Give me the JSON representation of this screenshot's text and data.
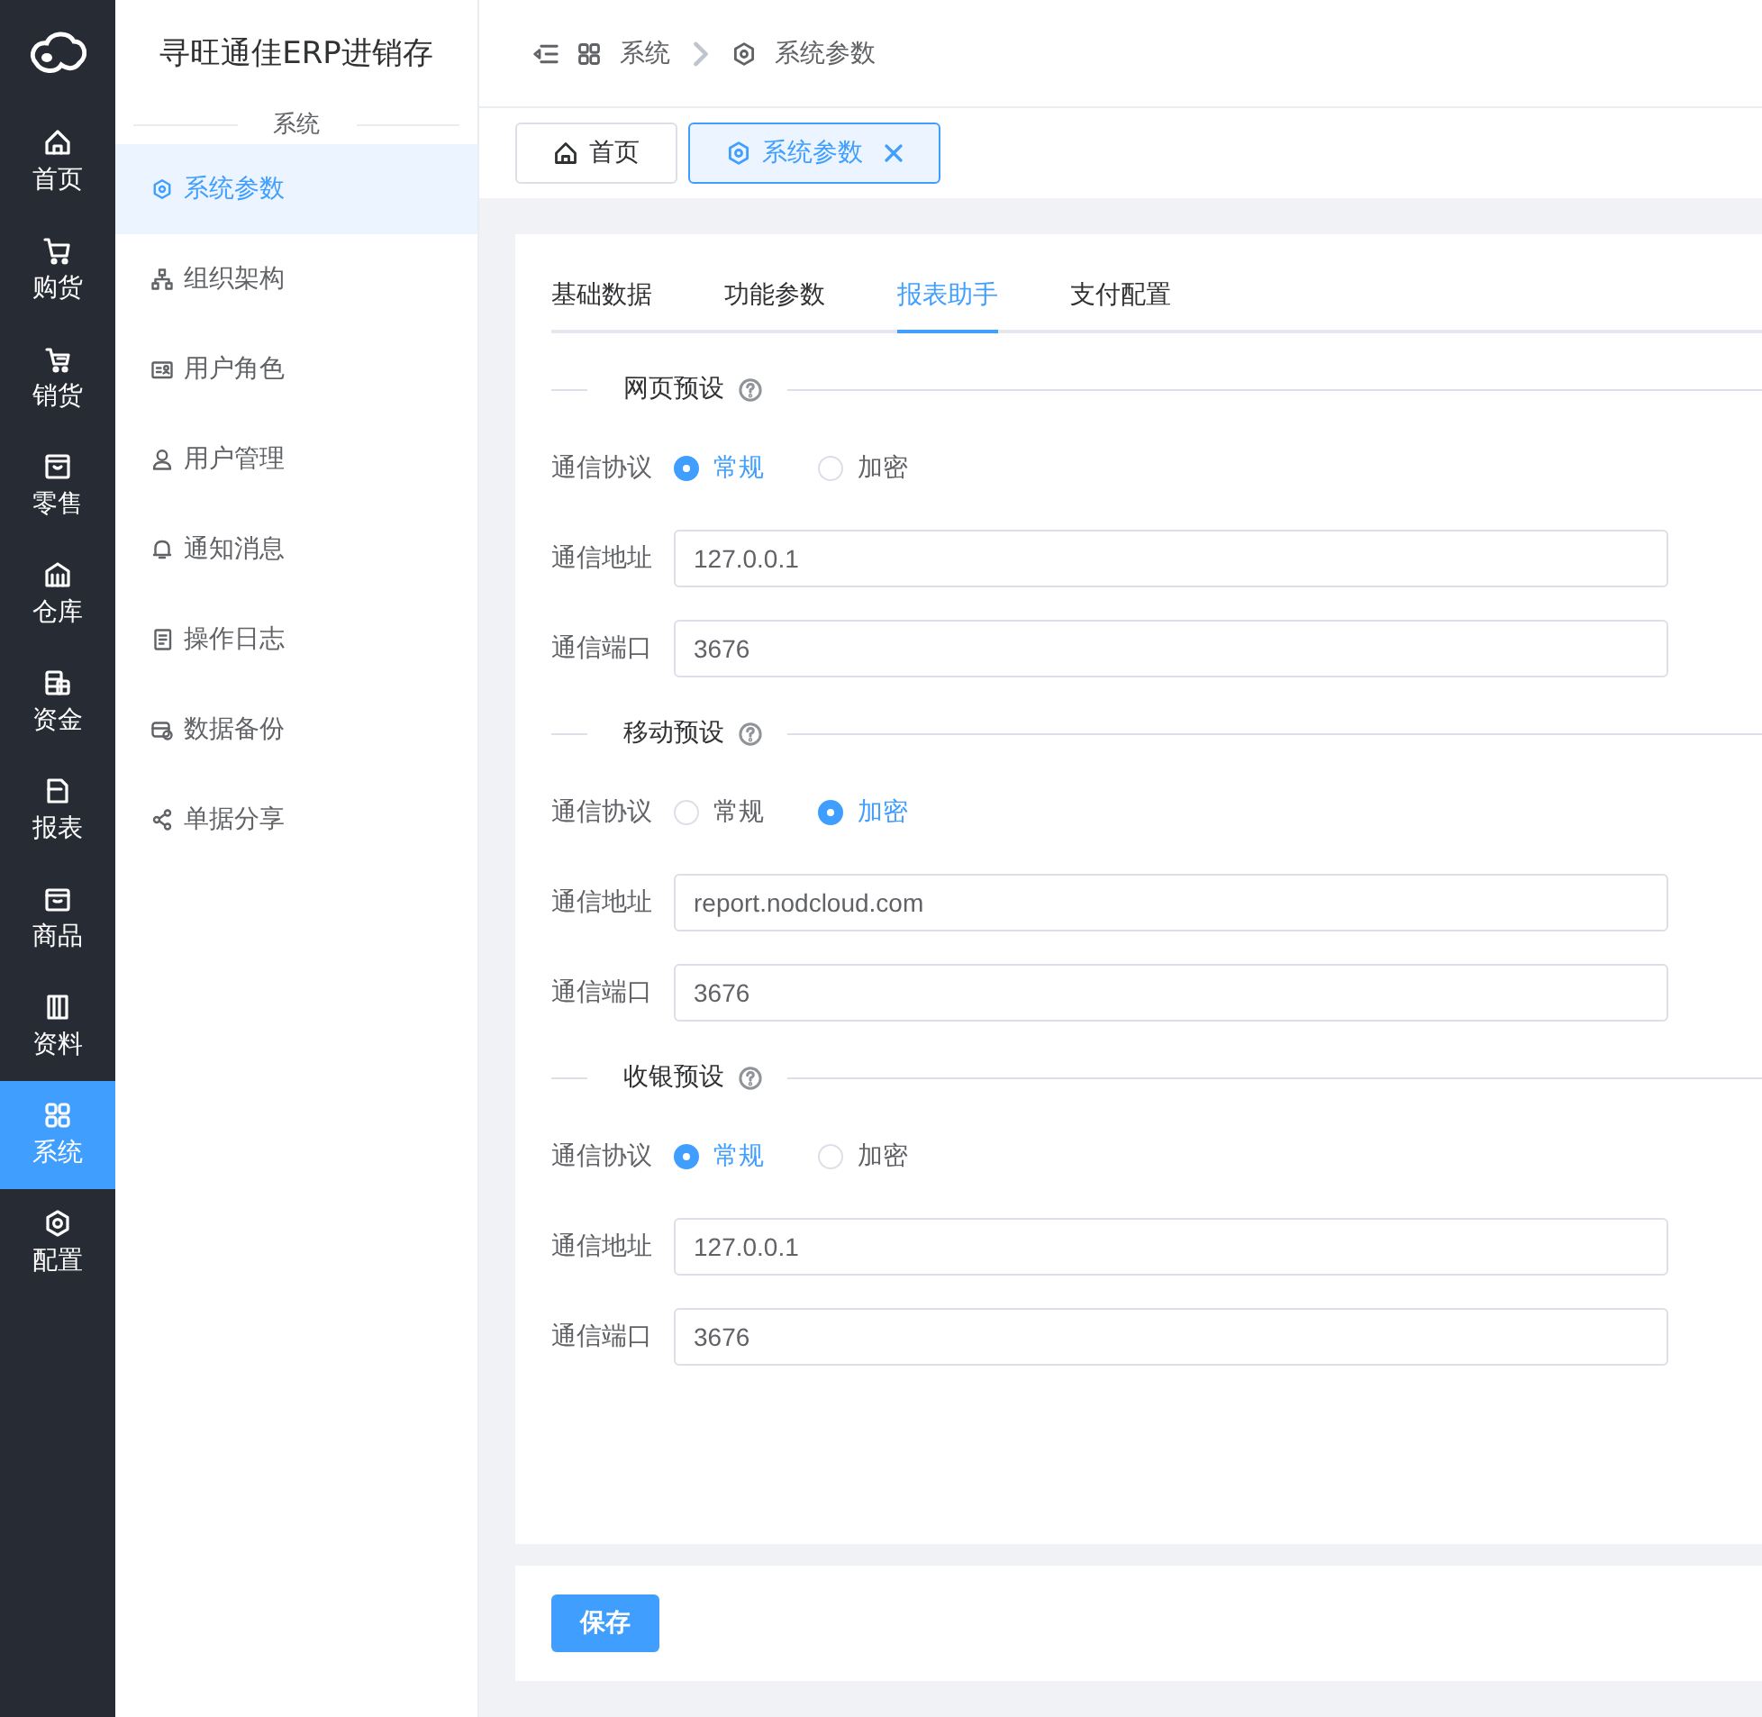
{
  "rail": {
    "items": [
      {
        "label": "首页",
        "selected": false
      },
      {
        "label": "购货",
        "selected": false
      },
      {
        "label": "销货",
        "selected": false
      },
      {
        "label": "零售",
        "selected": false
      },
      {
        "label": "仓库",
        "selected": false
      },
      {
        "label": "资金",
        "selected": false
      },
      {
        "label": "报表",
        "selected": false
      },
      {
        "label": "商品",
        "selected": false
      },
      {
        "label": "资料",
        "selected": false
      },
      {
        "label": "系统",
        "selected": true
      },
      {
        "label": "配置",
        "selected": false
      }
    ]
  },
  "sidebar": {
    "title": "寻旺通佳ERP进销存",
    "group": "系统",
    "items": [
      {
        "label": "系统参数",
        "selected": true
      },
      {
        "label": "组织架构",
        "selected": false
      },
      {
        "label": "用户角色",
        "selected": false
      },
      {
        "label": "用户管理",
        "selected": false
      },
      {
        "label": "通知消息",
        "selected": false
      },
      {
        "label": "操作日志",
        "selected": false
      },
      {
        "label": "数据备份",
        "selected": false
      },
      {
        "label": "单据分享",
        "selected": false
      }
    ]
  },
  "breadcrumb": [
    "系统",
    "系统参数"
  ],
  "page_tabs": [
    {
      "label": "首页",
      "selected": false,
      "closable": false
    },
    {
      "label": "系统参数",
      "selected": true,
      "closable": true
    }
  ],
  "tabs": [
    {
      "label": "基础数据",
      "selected": false
    },
    {
      "label": "功能参数",
      "selected": false
    },
    {
      "label": "报表助手",
      "selected": true
    },
    {
      "label": "支付配置",
      "selected": false
    }
  ],
  "sections": [
    {
      "title": "网页预设",
      "protocol": {
        "label": "通信协议",
        "options": [
          {
            "label": "常规",
            "selected": true
          },
          {
            "label": "加密",
            "selected": false
          }
        ]
      },
      "fields": [
        {
          "label": "通信地址",
          "value": "127.0.0.1"
        },
        {
          "label": "通信端口",
          "value": "3676"
        }
      ]
    },
    {
      "title": "移动预设",
      "protocol": {
        "label": "通信协议",
        "options": [
          {
            "label": "常规",
            "selected": false
          },
          {
            "label": "加密",
            "selected": true
          }
        ]
      },
      "fields": [
        {
          "label": "通信地址",
          "value": "report.nodcloud.com"
        },
        {
          "label": "通信端口",
          "value": "3676"
        }
      ]
    },
    {
      "title": "收银预设",
      "protocol": {
        "label": "通信协议",
        "options": [
          {
            "label": "常规",
            "selected": true
          },
          {
            "label": "加密",
            "selected": false
          }
        ]
      },
      "fields": [
        {
          "label": "通信地址",
          "value": "127.0.0.1"
        },
        {
          "label": "通信端口",
          "value": "3676"
        }
      ]
    }
  ],
  "save_button": "保存"
}
